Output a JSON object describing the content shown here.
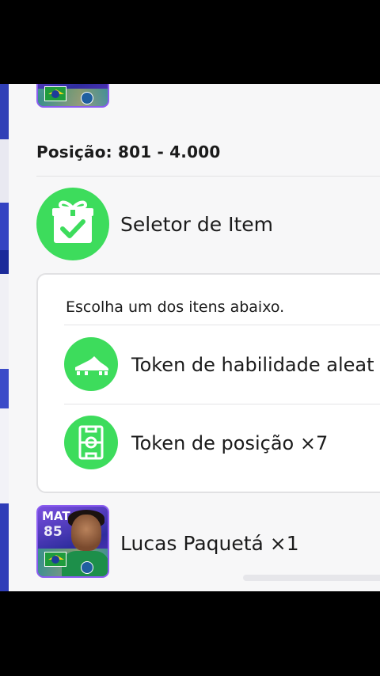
{
  "reward_tier": {
    "position_label": "Posição: 801 - 4.000"
  },
  "selector": {
    "title": "Seletor de Item",
    "icon": "gift-check-icon",
    "choose_prompt": "Escolha um dos itens abaixo.",
    "options": [
      {
        "label": "Token de habilidade aleat",
        "icon": "boot-icon"
      },
      {
        "label": "Token de posição ×7",
        "icon": "pitch-icon"
      }
    ]
  },
  "player_reward": {
    "label": "Lucas Paquetá ×1",
    "card_position": "MAT",
    "card_rating": "85"
  },
  "colors": {
    "accent_green": "#3ddc5c",
    "card_purple": "#7b4fe0",
    "panel_bg": "#f7f7f8"
  }
}
